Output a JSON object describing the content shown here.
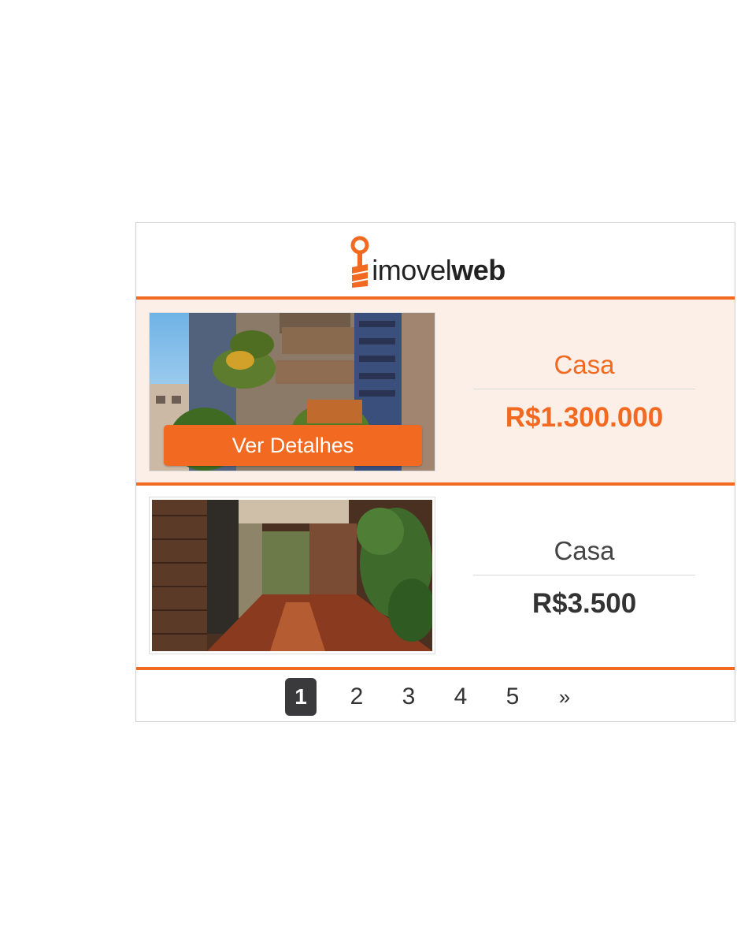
{
  "brand": {
    "name_regular": "imovel",
    "name_bold": "web",
    "accent_color": "#f26a21"
  },
  "listings": [
    {
      "type": "Casa",
      "price": "R$1.300.000",
      "button_label": "Ver Detalhes",
      "image": "building-exterior-photo",
      "highlighted": true
    },
    {
      "type": "Casa",
      "price": "R$3.500",
      "image": "interior-hallway-photo",
      "highlighted": false
    }
  ],
  "pagination": {
    "pages": [
      "1",
      "2",
      "3",
      "4",
      "5"
    ],
    "current": "1",
    "next_label": "»"
  },
  "colors": {
    "highlight_bg": "#fcefe8",
    "pager_active": "#3a3a3c"
  }
}
